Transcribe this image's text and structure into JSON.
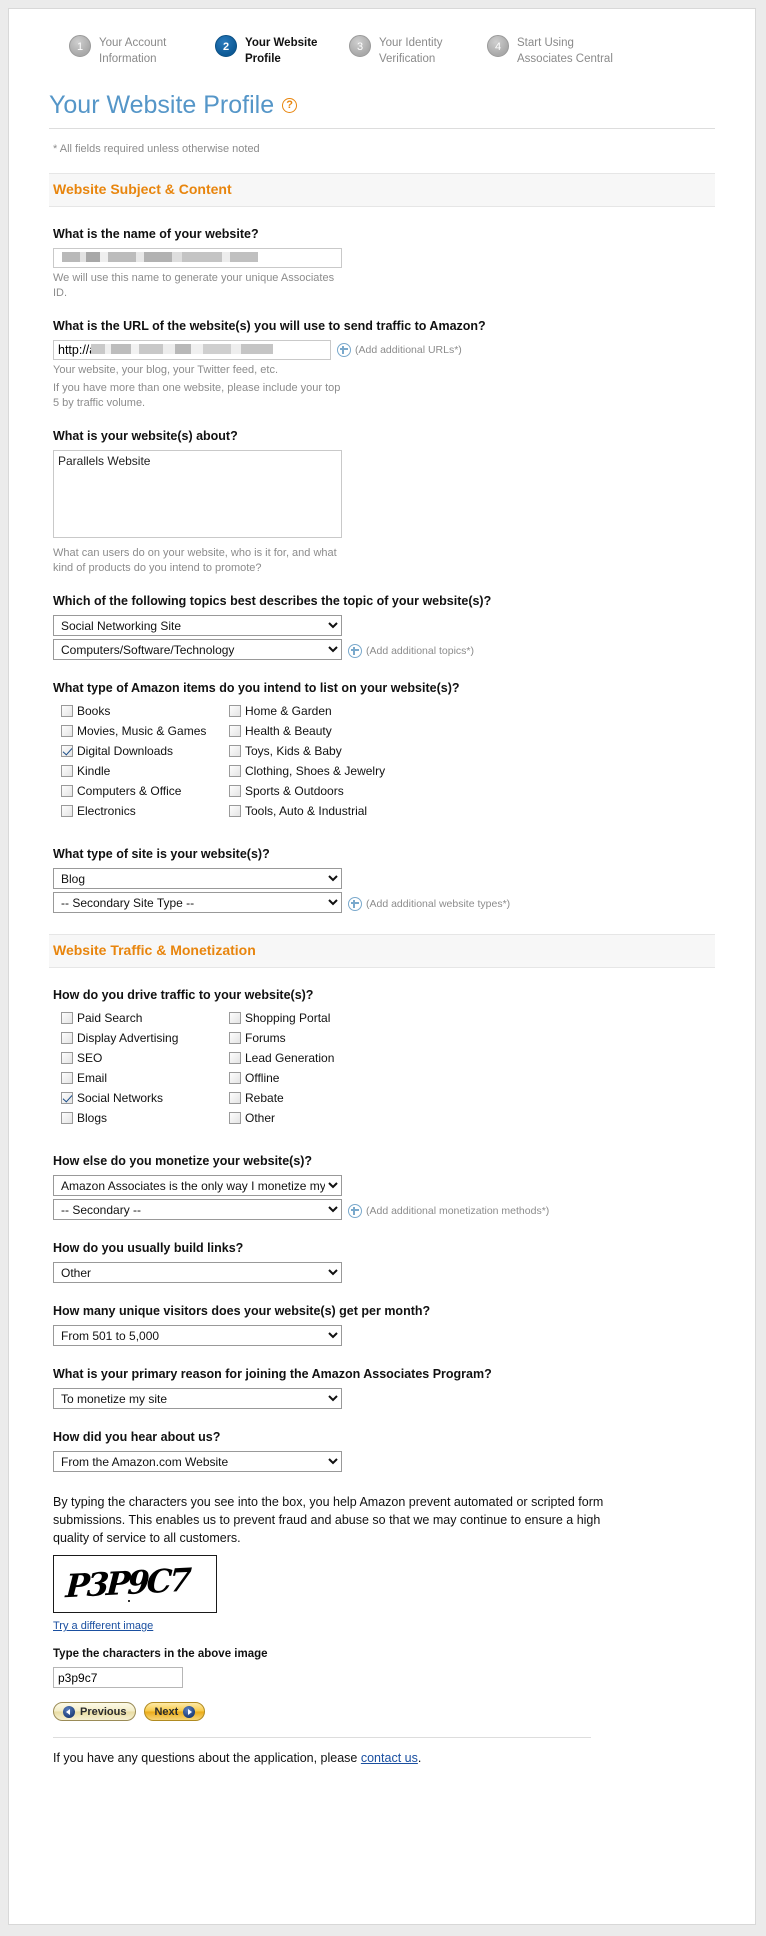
{
  "steps": [
    {
      "num": "1",
      "label": "Your Account Information",
      "active": false
    },
    {
      "num": "2",
      "label": "Your Website Profile",
      "active": true
    },
    {
      "num": "3",
      "label": "Your Identity Verification",
      "active": false
    },
    {
      "num": "4",
      "label": "Start Using Associates Central",
      "active": false
    }
  ],
  "page": {
    "title": "Your Website Profile",
    "help_icon": "?",
    "required_note": "* All fields required unless otherwise noted"
  },
  "section1": {
    "title": "Website Subject & Content",
    "name_question": "What is the name of your website?",
    "name_value": "",
    "name_hint": "We will use this name to generate your unique Associates ID.",
    "url_question": "What is the URL of the website(s) you will use to send traffic to Amazon?",
    "url_prefix": "http://a",
    "url_suffix": "/",
    "url_add_label": "(Add additional URLs*)",
    "url_hint_line1": "Your website, your blog, your Twitter feed, etc.",
    "url_hint_line2": "If you have more than one website, please include your top 5 by traffic volume.",
    "about_question": "What is your website(s) about?",
    "about_value": "Parallels Website",
    "about_hint": "What can users do on your website, who is it for, and what kind of products do you intend to promote?",
    "topics_question": "Which of the following topics best describes the topic of your website(s)?",
    "topic_primary": "Social Networking Site",
    "topic_secondary": "Computers/Software/Technology",
    "topics_add_label": "(Add additional topics*)",
    "items_question": "What type of Amazon items do you intend to list on your website(s)?",
    "items_left": [
      {
        "label": "Books",
        "checked": false
      },
      {
        "label": "Movies, Music & Games",
        "checked": false
      },
      {
        "label": "Digital Downloads",
        "checked": true
      },
      {
        "label": "Kindle",
        "checked": false
      },
      {
        "label": "Computers & Office",
        "checked": false
      },
      {
        "label": "Electronics",
        "checked": false
      }
    ],
    "items_right": [
      {
        "label": "Home & Garden",
        "checked": false
      },
      {
        "label": "Health & Beauty",
        "checked": false
      },
      {
        "label": "Toys, Kids & Baby",
        "checked": false
      },
      {
        "label": "Clothing, Shoes & Jewelry",
        "checked": false
      },
      {
        "label": "Sports & Outdoors",
        "checked": false
      },
      {
        "label": "Tools, Auto & Industrial",
        "checked": false
      }
    ],
    "sitetype_question": "What type of site is your website(s)?",
    "sitetype_primary": "Blog",
    "sitetype_secondary": "-- Secondary Site Type --",
    "sitetype_add_label": "(Add additional website types*)"
  },
  "section2": {
    "title": "Website Traffic & Monetization",
    "traffic_question": "How do you drive traffic to your website(s)?",
    "traffic_left": [
      {
        "label": "Paid Search",
        "checked": false
      },
      {
        "label": "Display Advertising",
        "checked": false
      },
      {
        "label": "SEO",
        "checked": false
      },
      {
        "label": "Email",
        "checked": false
      },
      {
        "label": "Social Networks",
        "checked": true
      },
      {
        "label": "Blogs",
        "checked": false
      }
    ],
    "traffic_right": [
      {
        "label": "Shopping Portal",
        "checked": false
      },
      {
        "label": "Forums",
        "checked": false
      },
      {
        "label": "Lead Generation",
        "checked": false
      },
      {
        "label": "Offline",
        "checked": false
      },
      {
        "label": "Rebate",
        "checked": false
      },
      {
        "label": "Other",
        "checked": false
      }
    ],
    "monetize_question": "How else do you monetize your website(s)?",
    "monetize_primary": "Amazon Associates is the only way I monetize my si",
    "monetize_secondary": "-- Secondary --",
    "monetize_add_label": "(Add additional monetization methods*)",
    "links_question": "How do you usually build links?",
    "links_value": "Other",
    "visitors_question": "How many unique visitors does your website(s) get per month?",
    "visitors_value": "From 501 to 5,000",
    "reason_question": "What is your primary reason for joining the Amazon Associates Program?",
    "reason_value": "To monetize my site",
    "hear_question": "How did you hear about us?",
    "hear_value": "From the Amazon.com Website"
  },
  "captcha": {
    "description": "By typing the characters you see into the box, you help Amazon prevent automated or scripted form submissions. This enables us to prevent fraud and abuse so that we may continue to ensure a high quality of service to all customers.",
    "image_text": "P3P9C7",
    "try_different": "Try a different image",
    "type_label": "Type the characters in the above image",
    "input_value": "p3p9c7"
  },
  "buttons": {
    "previous": "Previous",
    "next": "Next"
  },
  "footer": {
    "text_before": "If you have any questions about the application, please ",
    "link": "contact us",
    "text_after": "."
  }
}
